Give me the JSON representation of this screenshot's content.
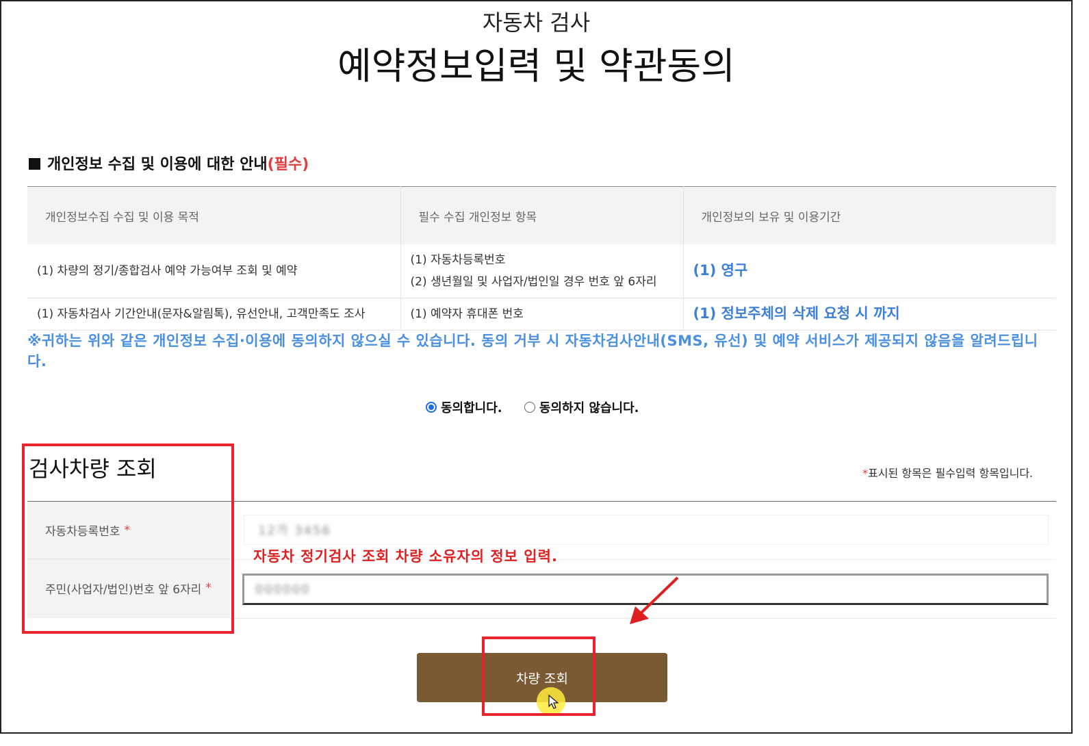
{
  "header": {
    "subtitle": "자동차 검사",
    "title": "예약정보입력 및 약관동의"
  },
  "privacy": {
    "heading": "개인정보 수집 및 이용에 대한 안내",
    "required_tag": "(필수)",
    "columns": [
      "개인정보수집 수집 및 이용 목적",
      "필수 수집 개인정보 항목",
      "개인정보의 보유 및 이용기간"
    ],
    "rows": [
      {
        "purpose": "(1) 차량의 정기/종합검사 예약 가능여부 조회 및 예약",
        "items": [
          "(1) 자동차등록번호",
          "(2) 생년월일 및 사업자/법인일 경우 번호 앞 6자리"
        ],
        "period": "(1) 영구"
      },
      {
        "purpose": "(1) 자동차검사 기간안내(문자&알림톡), 유선안내, 고객만족도 조사",
        "items": [
          "(1) 예약자 휴대폰 번호"
        ],
        "period": "(1) 정보주체의 삭제 요청 시 까지"
      }
    ],
    "notice": "※귀하는 위와 같은 개인정보 수집·이용에 동의하지 않으실 수 있습니다. 동의 거부 시 자동차검사안내(SMS, 유선) 및 예약 서비스가 제공되지 않음을 알려드립니다."
  },
  "consent": {
    "agree": "동의합니다.",
    "disagree": "동의하지 않습니다.",
    "selected": "agree"
  },
  "form": {
    "title": "검사차량 조회",
    "required_note_star": "*",
    "required_note": "표시된 항목은 필수입력 항목입니다.",
    "fields": [
      {
        "label": "자동차등록번호",
        "star": "*",
        "value": "12가 3456"
      },
      {
        "label": "주민(사업자/법인)번호 앞 6자리",
        "star": "*",
        "value": "000000"
      }
    ],
    "annotation": "자동차 정기검사 조회 차량 소유자의 정보 입력.",
    "submit": "차량 조회"
  },
  "colors": {
    "accent_brown": "#7a5a33",
    "highlight_red": "#e8232c",
    "notice_blue": "#4a90e2",
    "radio_blue": "#1a6fe0"
  }
}
